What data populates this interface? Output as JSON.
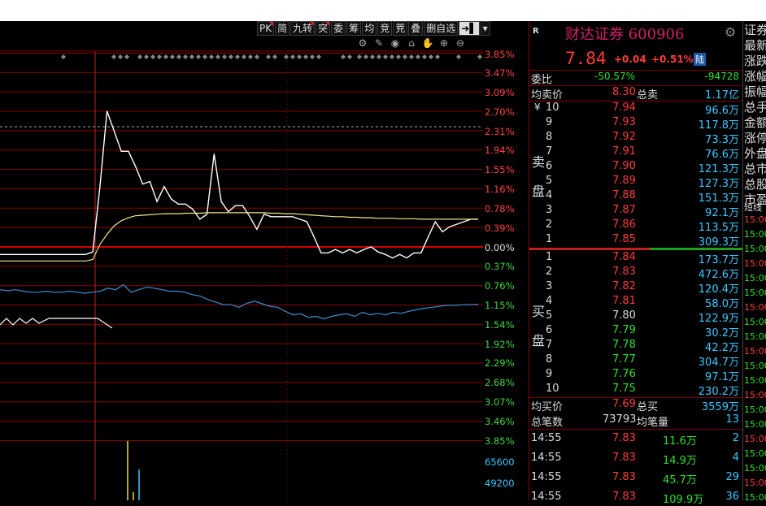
{
  "toolbar": {
    "buttons": [
      "PK",
      "简",
      "九转",
      "突",
      "委",
      "筹",
      "均",
      "竞",
      "茺",
      "叠",
      "删自选"
    ],
    "arrow_label": "➜▌",
    "dropdown": "▾"
  },
  "pct_axis": {
    "up": [
      "3.85%",
      "3.47%",
      "3.09%",
      "2.70%",
      "2.31%",
      "1.94%",
      "1.55%",
      "1.16%",
      "0.78%",
      "0.39%"
    ],
    "zero": "0.00%",
    "down": [
      "0.37%",
      "0.76%",
      "1.15%",
      "1.54%",
      "1.92%",
      "2.29%",
      "2.68%",
      "3.07%",
      "3.46%",
      "3.85%"
    ],
    "volume": [
      "65600",
      "49200"
    ]
  },
  "stock": {
    "badge": "R",
    "name_code": "财达证券 600906",
    "price": "7.84",
    "change": "+0.04",
    "change_pct": "+0.51%",
    "market_tag": "陆"
  },
  "ratio": {
    "label": "委比",
    "pct": "-50.57%",
    "diff": "-94728"
  },
  "avg_sell": {
    "label": "均卖价",
    "value": "8.30",
    "total_label": "总卖",
    "total": "1.17亿"
  },
  "sell_side_labels": [
    "卖",
    "盘"
  ],
  "buy_side_labels": [
    "买",
    "盘"
  ],
  "sell_levels": [
    {
      "level": "10",
      "price": "7.94",
      "vol": "96.6万",
      "color": "red"
    },
    {
      "level": "9",
      "price": "7.93",
      "vol": "117.8万",
      "color": "red"
    },
    {
      "level": "8",
      "price": "7.92",
      "vol": "73.3万",
      "color": "red"
    },
    {
      "level": "7",
      "price": "7.91",
      "vol": "76.6万",
      "color": "red"
    },
    {
      "level": "6",
      "price": "7.90",
      "vol": "121.3万",
      "color": "red"
    },
    {
      "level": "5",
      "price": "7.89",
      "vol": "127.3万",
      "color": "red"
    },
    {
      "level": "4",
      "price": "7.88",
      "vol": "151.3万",
      "color": "red"
    },
    {
      "level": "3",
      "price": "7.87",
      "vol": "92.1万",
      "color": "red"
    },
    {
      "level": "2",
      "price": "7.86",
      "vol": "113.5万",
      "color": "red"
    },
    {
      "level": "1",
      "price": "7.85",
      "vol": "309.3万",
      "color": "red"
    }
  ],
  "buy_levels": [
    {
      "level": "1",
      "price": "7.84",
      "vol": "173.7万",
      "color": "red"
    },
    {
      "level": "2",
      "price": "7.83",
      "vol": "472.6万",
      "color": "red"
    },
    {
      "level": "3",
      "price": "7.82",
      "vol": "120.4万",
      "color": "red"
    },
    {
      "level": "4",
      "price": "7.81",
      "vol": "58.0万",
      "color": "red"
    },
    {
      "level": "5",
      "price": "7.80",
      "vol": "122.9万",
      "color": "white"
    },
    {
      "level": "6",
      "price": "7.79",
      "vol": "30.2万",
      "color": "green"
    },
    {
      "level": "7",
      "price": "7.78",
      "vol": "42.2万",
      "color": "green"
    },
    {
      "level": "8",
      "price": "7.77",
      "vol": "304.7万",
      "color": "green"
    },
    {
      "level": "9",
      "price": "7.76",
      "vol": "97.1万",
      "color": "green"
    },
    {
      "level": "10",
      "price": "7.75",
      "vol": "230.2万",
      "color": "green"
    }
  ],
  "yen_mark": "¥",
  "avg_buy": {
    "label": "均买价",
    "value": "7.69",
    "total_label": "总买",
    "total": "3559万"
  },
  "trades_summary": {
    "label": "总笔数",
    "value": "73793",
    "avg_label": "均笔量",
    "avg": "13"
  },
  "ticks": [
    {
      "time": "14:55",
      "price": "7.83",
      "vol": "11.6万",
      "count": "2"
    },
    {
      "time": "14:55",
      "price": "7.83",
      "vol": "14.9万",
      "count": "4"
    },
    {
      "time": "14:55",
      "price": "7.83",
      "vol": "45.7万",
      "count": "29"
    },
    {
      "time": "14:55",
      "price": "7.83",
      "vol": "109.9万",
      "count": "36"
    }
  ],
  "far_panel": {
    "labels": [
      "证券",
      "最新",
      "涨跌",
      "涨幅",
      "振幅",
      "总手",
      "金额",
      "涨停",
      "外盘",
      "总市",
      "总股",
      "市盈"
    ],
    "short_label": "短线",
    "times": [
      "15:00",
      "15:00",
      "15:00",
      "15:00",
      "15:00",
      "15:00",
      "15:00",
      "15:00",
      "15:00",
      "15:00",
      "15:00",
      "15:00",
      "15:00",
      "15:00",
      "15:00",
      "15:00",
      "15:00",
      "15:00",
      "15:00",
      "15:00"
    ]
  },
  "colors": {
    "up": "#ff3b3b",
    "down": "#30e030",
    "volume": "#3cc8ff",
    "grid": "#8a0000",
    "price_line": "#ffffff",
    "avg_line": "#f0e68c",
    "index_line": "#3c8ccf"
  },
  "chart_data": {
    "type": "line",
    "title": "",
    "xlabel": "",
    "ylabel": "",
    "ylim_pct": [
      -3.85,
      3.85
    ],
    "grid": true,
    "series": [
      {
        "color": "white",
        "values": [
          -0.15,
          -0.15,
          -0.15,
          -0.15,
          -0.15,
          -0.15,
          -0.15,
          -0.15,
          -0.15,
          -0.15,
          -0.15,
          -0.15,
          -0.15,
          -0.1,
          1.2,
          2.7,
          2.3,
          1.9,
          1.9,
          1.6,
          1.25,
          1.3,
          0.9,
          1.2,
          0.95,
          0.85,
          0.85,
          0.75,
          0.55,
          0.65,
          1.85,
          0.9,
          0.7,
          0.82,
          0.82,
          0.6,
          0.35,
          0.65,
          0.6,
          0.6,
          0.6,
          0.6,
          0.55,
          0.5,
          0.2,
          -0.12,
          -0.12,
          -0.05,
          -0.12,
          -0.05,
          -0.12,
          -0.05,
          0.0,
          -0.1,
          -0.15,
          -0.22,
          -0.15,
          -0.22,
          -0.12,
          -0.12,
          0.2,
          0.5,
          0.3,
          0.4,
          0.45,
          0.5,
          0.55,
          0.55
        ]
      },
      {
        "color": "yellow",
        "values": [
          -0.28,
          -0.28,
          -0.28,
          -0.28,
          -0.28,
          -0.28,
          -0.28,
          -0.28,
          -0.28,
          -0.28,
          -0.28,
          -0.28,
          -0.28,
          -0.25,
          0.05,
          0.25,
          0.42,
          0.52,
          0.58,
          0.62,
          0.63,
          0.64,
          0.65,
          0.66,
          0.66,
          0.66,
          0.67,
          0.67,
          0.67,
          0.68,
          0.68,
          0.68,
          0.68,
          0.68,
          0.68,
          0.68,
          0.68,
          0.68,
          0.67,
          0.67,
          0.66,
          0.66,
          0.65,
          0.64,
          0.63,
          0.62,
          0.61,
          0.6,
          0.6,
          0.59,
          0.59,
          0.58,
          0.58,
          0.57,
          0.57,
          0.57,
          0.56,
          0.56,
          0.56,
          0.55,
          0.55,
          0.55,
          0.55,
          0.55,
          0.55,
          0.55,
          0.55,
          0.55
        ]
      }
    ]
  }
}
